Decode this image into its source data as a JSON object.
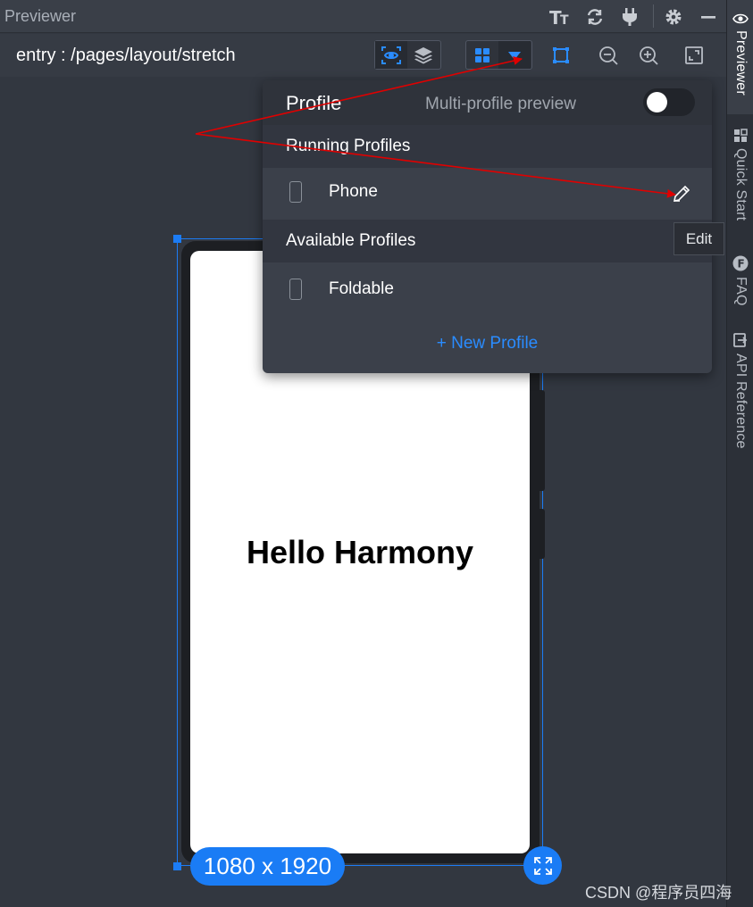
{
  "titlebar": {
    "title": "Previewer"
  },
  "toolbar": {
    "path": "entry : /pages/layout/stretch"
  },
  "sidebar": {
    "tabs": [
      {
        "label": "Previewer",
        "icon": "eye-icon"
      },
      {
        "label": "Quick Start",
        "icon": "grid-icon"
      },
      {
        "label": "FAQ",
        "icon": "faq-icon"
      },
      {
        "label": "API Reference",
        "icon": "book-icon"
      }
    ]
  },
  "profile_popup": {
    "title": "Profile",
    "multi_label": "Multi-profile preview",
    "multi_enabled": false,
    "running_header": "Running Profiles",
    "running": [
      {
        "name": "Phone"
      }
    ],
    "available_header": "Available Profiles",
    "available": [
      {
        "name": "Foldable"
      }
    ],
    "new_profile": "+ New Profile"
  },
  "tooltip": {
    "text": "Edit"
  },
  "device": {
    "content": "Hello Harmony",
    "resolution": "1080 x 1920"
  },
  "watermark": "CSDN @程序员四海",
  "colors": {
    "accent": "#1a7cf5",
    "annotation": "#e00000"
  }
}
